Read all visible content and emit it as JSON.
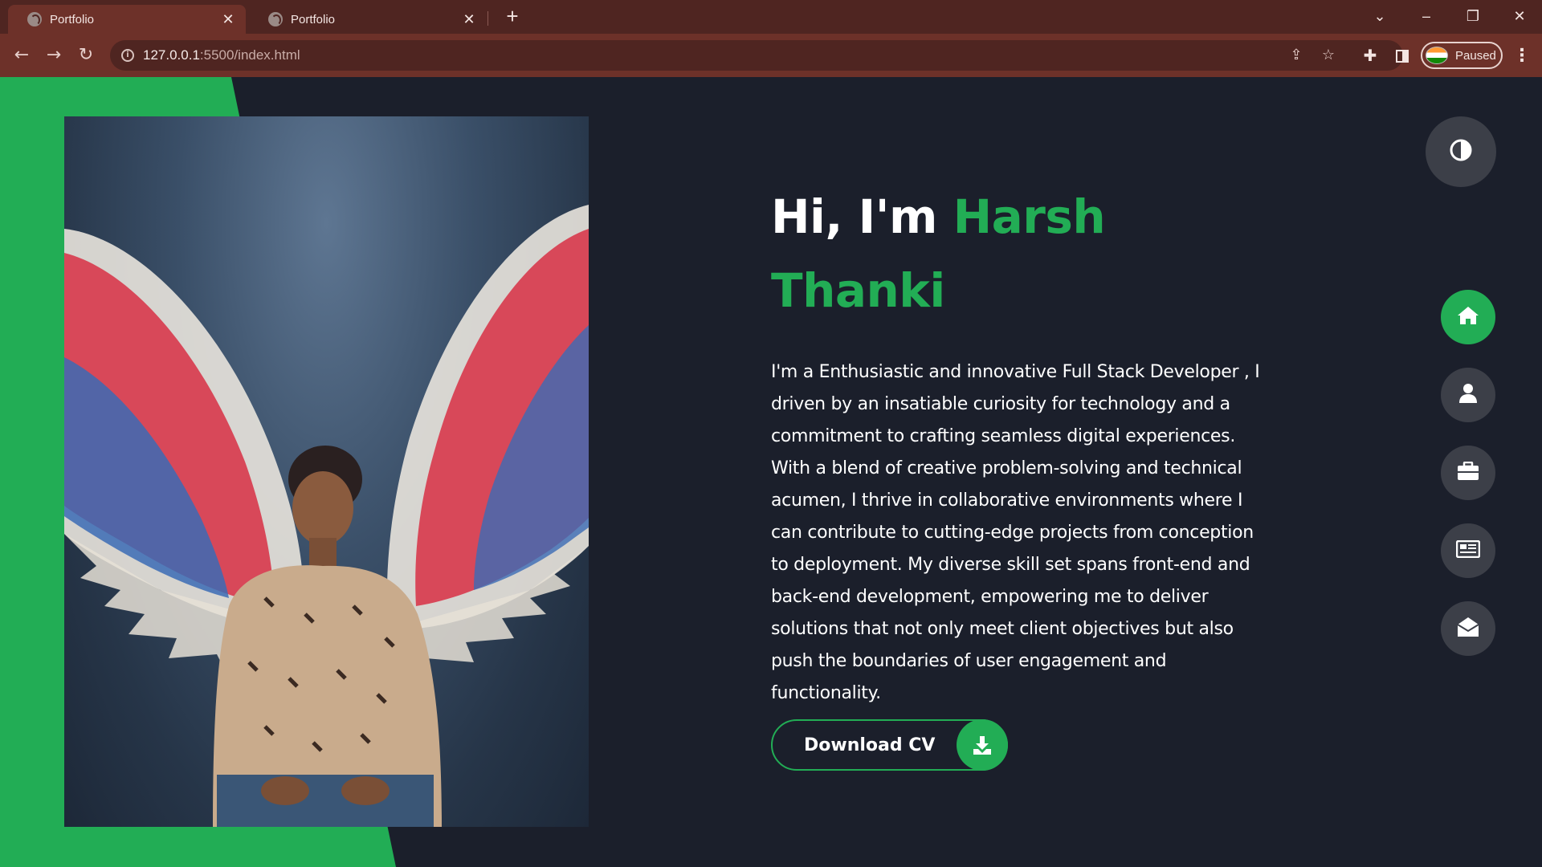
{
  "browser": {
    "tabs": [
      {
        "title": "Portfolio",
        "active": true
      },
      {
        "title": "Portfolio",
        "active": false
      }
    ],
    "new_tab_label": "+",
    "url_host": "127.0.0.1",
    "url_rest": ":5500/index.html",
    "profile_status": "Paused",
    "window_controls": {
      "minimize": "–",
      "restore": "❐",
      "close": "✕",
      "tab_search": "⌄"
    }
  },
  "hero": {
    "greeting": "Hi, I'm ",
    "first_name": "Harsh",
    "last_name": "Thanki",
    "bio": "I'm a Enthusiastic and innovative Full Stack Developer , I driven by an insatiable curiosity for technology and a commitment to crafting seamless digital experiences. With a blend of creative problem-solving and technical acumen, I thrive in collaborative environments where I can contribute to cutting-edge projects from conception to deployment. My diverse skill set spans front-end and back-end development, empowering me to deliver solutions that not only meet client objectives but also push the boundaries of user engagement and functionality.",
    "cv_button_label": "Download CV"
  },
  "side_nav": {
    "items": [
      {
        "name": "home",
        "icon": "home-icon",
        "active": true
      },
      {
        "name": "about",
        "icon": "user-icon",
        "active": false
      },
      {
        "name": "portfolio",
        "icon": "briefcase-icon",
        "active": false
      },
      {
        "name": "blog",
        "icon": "newspaper-icon",
        "active": false
      },
      {
        "name": "contact",
        "icon": "envelope-open-icon",
        "active": false
      }
    ]
  },
  "colors": {
    "accent": "#22ad55",
    "background": "#1b1f2b",
    "nav_button": "#3c3f48",
    "chrome_frame": "#4f2521",
    "chrome_toolbar": "#6d3129"
  }
}
